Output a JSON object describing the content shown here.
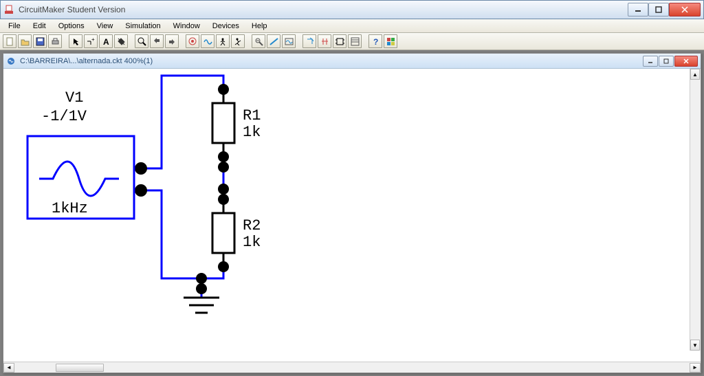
{
  "window": {
    "title": "CircuitMaker Student Version"
  },
  "menu": {
    "items": [
      "File",
      "Edit",
      "Options",
      "View",
      "Simulation",
      "Window",
      "Devices",
      "Help"
    ]
  },
  "document": {
    "title": "C:\\BARREIRA\\...\\alternada.ckt 400%(1)"
  },
  "circuit": {
    "source": {
      "name": "V1",
      "amplitude": "-1/1V",
      "frequency": "1kHz"
    },
    "r1": {
      "name": "R1",
      "value": "1k"
    },
    "r2": {
      "name": "R2",
      "value": "1k"
    }
  },
  "toolbar_icons": [
    "new-file-icon",
    "open-file-icon",
    "save-icon",
    "print-icon",
    "sep",
    "pointer-icon",
    "wire-icon",
    "text-icon",
    "delete-icon",
    "sep",
    "zoom-icon",
    "zoom-out-icon",
    "zoom-in-icon",
    "sep",
    "digital-icon",
    "analog-icon",
    "walk-icon",
    "run-icon",
    "sep",
    "probe-icon",
    "scope-icon",
    "trace-icon",
    "sep",
    "rotate-icon",
    "flip-icon",
    "macro-icon",
    "parts-icon",
    "sep",
    "help-icon",
    "palette-icon"
  ]
}
